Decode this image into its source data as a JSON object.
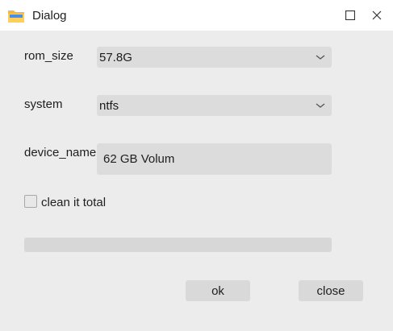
{
  "window": {
    "title": "Dialog"
  },
  "icons": {
    "app": "folder-icon",
    "maximize": "maximize-icon",
    "close": "close-icon",
    "dropdown": "chevron-down-icon"
  },
  "form": {
    "rom_size": {
      "label": "rom_size",
      "value": "57.8G"
    },
    "system": {
      "label": "system",
      "value": "ntfs"
    },
    "device_name": {
      "label": "device_name",
      "value": "62 GB Volum"
    },
    "clean": {
      "label": "clean it total",
      "checked": false
    },
    "progress": {
      "value": 0
    }
  },
  "buttons": {
    "ok": "ok",
    "close": "close"
  }
}
